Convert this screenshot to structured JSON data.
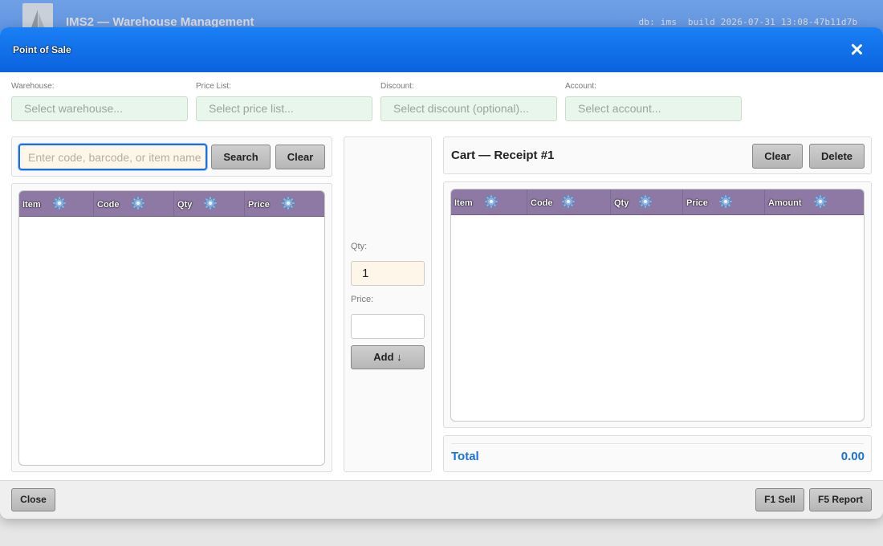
{
  "app": {
    "title": "IMS2 — Warehouse Management",
    "meta": "db: ims  build 2026-07-31 13:08-47b11d7b  "
  },
  "dialog": {
    "title": "Point of Sale"
  },
  "filters": {
    "warehouse": {
      "label": "Warehouse:",
      "placeholder": "Select warehouse..."
    },
    "price_list": {
      "label": "Price List:",
      "placeholder": "Select price list..."
    },
    "discount": {
      "label": "Discount:",
      "placeholder": "Select discount (optional)..."
    },
    "account": {
      "label": "Account:",
      "placeholder": "Select account..."
    }
  },
  "search": {
    "placeholder": "Enter code, barcode, or item name",
    "search_label": "Search",
    "clear_label": "Clear"
  },
  "items_grid": {
    "columns": [
      "Item",
      "Code",
      "Qty",
      "Price"
    ],
    "rows": []
  },
  "entry": {
    "qty_label": "Qty:",
    "qty_value": "1",
    "price_label": "Price:",
    "price_value": "",
    "add_label": "Add ↓"
  },
  "cart": {
    "title": "Cart — Receipt #1",
    "clear_label": "Clear",
    "delete_label": "Delete",
    "columns": [
      "Item",
      "Code",
      "Qty",
      "Price",
      "Amount"
    ],
    "rows": []
  },
  "total": {
    "label": "Total",
    "value": "0.00"
  },
  "footer": {
    "close_label": "Close",
    "sell_label": "F1 Sell",
    "report_label": "F5 Report"
  },
  "colors": {
    "header_blue": "#0a63de",
    "grid_header": "#8e78a4",
    "total_blue": "#1a72d8",
    "filter_bg": "#e9f6ec"
  },
  "icons": {
    "column_settings": "gear-icon",
    "close": "close-icon",
    "logo": "sail-logo-icon"
  }
}
